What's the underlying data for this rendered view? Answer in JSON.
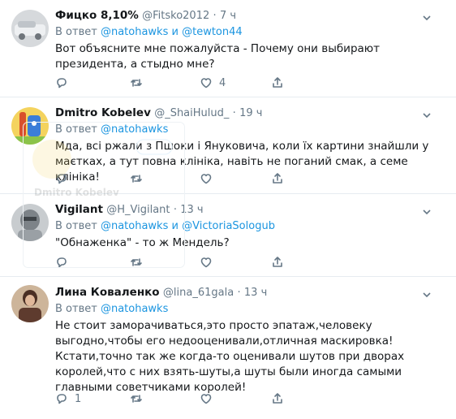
{
  "tweets": [
    {
      "name": "Фицко 8,10%",
      "handle": "@Fitsko2012",
      "sep": "·",
      "time": "7 ч",
      "reply_prefix": "В ответ",
      "reply_user1": "@natohawks",
      "reply_and": "и",
      "reply_user2": "@tewton44",
      "text": "Вот объясните мне пожалуйста - Почему они выбирают президента, а стыдно мне?",
      "reply_count": "",
      "retweet_count": "",
      "like_count": "4",
      "avatar_colors": [
        "#c9ccd0",
        "#e9ecef"
      ]
    },
    {
      "name": "Dmitro Kobelev",
      "handle": "@_ShaiHulud_",
      "sep": "·",
      "time": "19 ч",
      "reply_prefix": "В ответ",
      "reply_user1": "@natohawks",
      "text": "Мда, всі ржали з Пшоки і Януковича, коли їх картини знайшли у маєтках, а тут повна клініка, навіть не поганий смак, а семе клініка!",
      "reply_count": "",
      "retweet_count": "",
      "like_count": "",
      "avatar_colors": [
        "#f2c94c",
        "#4a90d9"
      ],
      "ghost_name": "Dmitro Kobelev"
    },
    {
      "name": "Vigilant",
      "handle": "@H_Vigilant",
      "sep": "·",
      "time": "13 ч",
      "reply_prefix": "В ответ",
      "reply_user1": "@natohawks",
      "reply_and": "и",
      "reply_user2": "@VictoriaSologub",
      "text": "\"Обнаженка\" - то ж Мендель?",
      "reply_count": "",
      "retweet_count": "",
      "like_count": "",
      "avatar_colors": [
        "#8a8f95",
        "#cfd3d6"
      ]
    },
    {
      "name": "Лина Коваленко",
      "handle": "@lina_61gala",
      "sep": "·",
      "time": "13 ч",
      "reply_prefix": "В ответ",
      "reply_user1": "@natohawks",
      "text_lines": [
        "Не стоит заморачиваться,это просто эпатаж,человеку выгодно,чтобы его недооценивали,отличная маскировка!",
        "Кстати,точно так же когда-то оценивали шутов при дворах королей,что с них взять-шуты,а шуты были иногда самыми главными советчиками королей!"
      ],
      "reply_count": "1",
      "retweet_count": "",
      "like_count": "",
      "avatar_colors": [
        "#6b4a3a",
        "#b89a7a"
      ]
    }
  ]
}
